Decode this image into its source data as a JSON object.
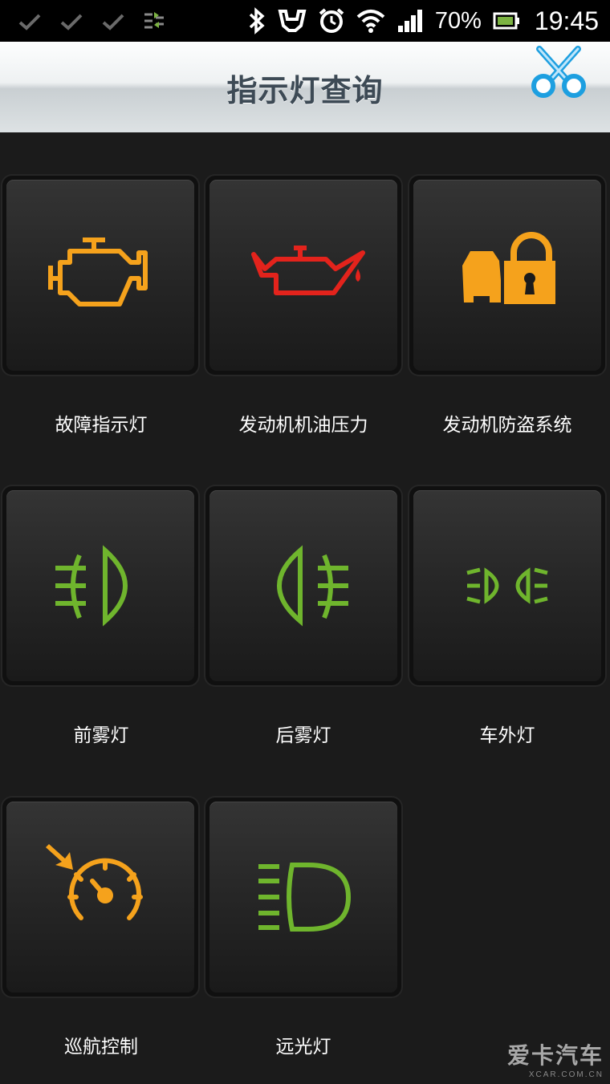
{
  "status_bar": {
    "battery_percent": "70%",
    "time": "19:45",
    "icons": [
      "check-icon",
      "check-icon",
      "check-icon",
      "usb-transfer-icon",
      "bluetooth-icon",
      "car-cradle-icon",
      "alarm-clock-icon",
      "wifi-icon",
      "signal-icon",
      "battery-icon"
    ]
  },
  "header": {
    "title": "指示灯查询",
    "action_icon": "scissors-icon"
  },
  "indicators": [
    {
      "label": "故障指示灯",
      "icon": "engine-icon",
      "color": "#f5a21c"
    },
    {
      "label": "发动机机油压力",
      "icon": "oil-can-icon",
      "color": "#e3231c"
    },
    {
      "label": "发动机防盗系统",
      "icon": "car-lock-icon",
      "color": "#f5a21c"
    },
    {
      "label": "前雾灯",
      "icon": "front-fog-light-icon",
      "color": "#6fb52d"
    },
    {
      "label": "后雾灯",
      "icon": "rear-fog-light-icon",
      "color": "#6fb52d"
    },
    {
      "label": "车外灯",
      "icon": "exterior-light-icon",
      "color": "#6fb52d"
    },
    {
      "label": "巡航控制",
      "icon": "cruise-control-icon",
      "color": "#f5a21c"
    },
    {
      "label": "远光灯",
      "icon": "high-beam-icon",
      "color": "#6fb52d"
    }
  ],
  "watermark": {
    "line1": "爱卡汽车",
    "line2": "XCAR.COM.CN"
  }
}
